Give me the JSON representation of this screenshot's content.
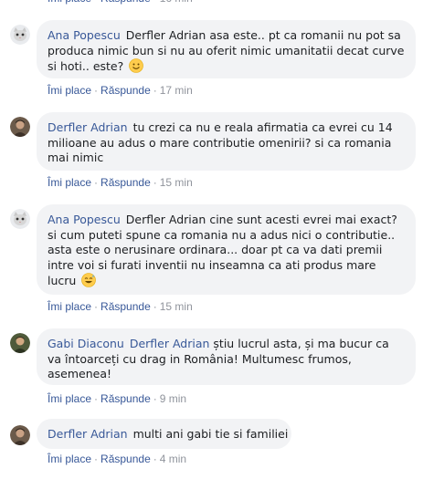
{
  "comments": [
    {
      "author": "Ana Popescu",
      "text": "Derfler Adrian asa este.. pt ca romanii nu pot sa produca nimic bun si nu au oferit nimic umanitatii decat curve si hoti.. este?",
      "emoji": "smiling-face",
      "like": "Îmi place",
      "reply": "Răspunde",
      "time": "17 min"
    },
    {
      "author": "Derfler Adrian",
      "text": "tu crezi ca nu e reala afirmatia ca evrei cu 14 milioane au adus o mare contributie omenirii? si ca romania mai nimic",
      "like": "Îmi place",
      "reply": "Răspunde",
      "time": "15 min"
    },
    {
      "author": "Ana Popescu",
      "text": "Derfler Adrian cine sunt acesti evrei mai exact? si cum puteti spune ca romania nu a adus nici o contributie.. asta este o nerusinare ordinara... doar pt ca va dati premii intre voi si furati inventii nu inseamna ca ati produs mare lucru",
      "emoji": "grinning-sweat-face",
      "like": "Îmi place",
      "reply": "Răspunde",
      "time": "15 min"
    },
    {
      "author": "Gabi Diaconu",
      "mention": "Derfler Adrian",
      "text": "știu lucrul asta, și ma bucur ca va întoarceți cu drag in România! Multumesc frumos, asemenea!",
      "like": "Îmi place",
      "reply": "Răspunde",
      "time": "9 min"
    },
    {
      "author": "Derfler Adrian",
      "text": "multi ani gabi tie si familiei",
      "like": "Îmi place",
      "reply": "Răspunde",
      "time": "4 min"
    }
  ],
  "colors": {
    "link": "#385898",
    "bubble": "#f2f3f5",
    "meta": "#90949c"
  }
}
